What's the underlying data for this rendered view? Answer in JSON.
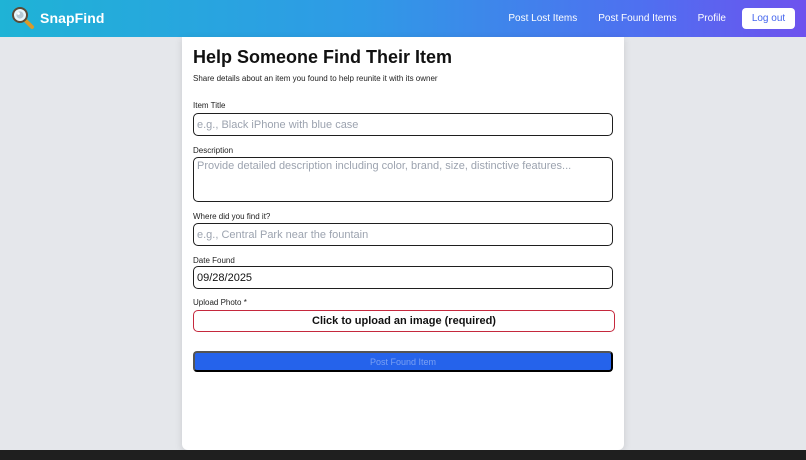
{
  "nav": {
    "brand": "SnapFind",
    "links": [
      "Post Lost Items",
      "Post Found Items",
      "Profile"
    ],
    "logout": "Log out"
  },
  "form": {
    "title": "Help Someone Find Their Item",
    "subtitle": "Share details about an item you found to help reunite it with its owner",
    "item_title": {
      "label": "Item Title",
      "placeholder": "e.g., Black iPhone with blue case"
    },
    "description": {
      "label": "Description",
      "placeholder": "Provide detailed description including color, brand, size, distinctive features..."
    },
    "location": {
      "label": "Where did you find it?",
      "placeholder": "e.g., Central Park near the fountain"
    },
    "date": {
      "label": "Date Found",
      "value": "09/28/2025"
    },
    "photo": {
      "label": "Upload Photo *",
      "prompt": "Click to upload an image (required)"
    },
    "submit": "Post Found Item"
  },
  "colors": {
    "accent": "#2563eb",
    "upload_border": "#c5283d"
  }
}
